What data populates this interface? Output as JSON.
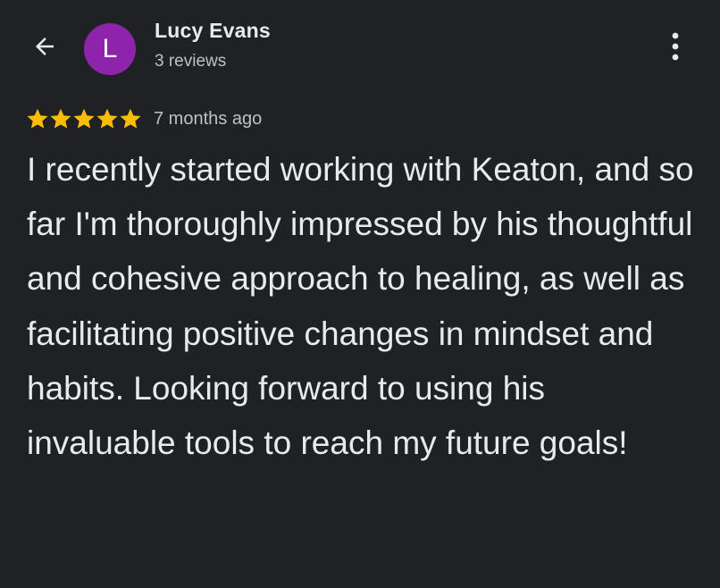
{
  "reviewer": {
    "avatar_initial": "L",
    "avatar_color": "#8e24aa",
    "name": "Lucy Evans",
    "review_count": "3 reviews"
  },
  "review": {
    "rating": 5,
    "max_rating": 5,
    "star_color": "#fbbc04",
    "date": "7 months ago",
    "text": "I recently started working with Keaton, and so far I'm thoroughly impressed by his thoughtful and cohesive approach to healing, as well as facilitating positive changes in mindset and habits. Looking forward to using his invaluable tools to reach my future goals!"
  },
  "icons": {
    "back": "arrow-back-icon",
    "more": "more-vert-icon",
    "star": "star-icon"
  },
  "theme": {
    "background": "#202124",
    "text_primary": "#e8eaed",
    "text_secondary": "#bdc1c6"
  }
}
